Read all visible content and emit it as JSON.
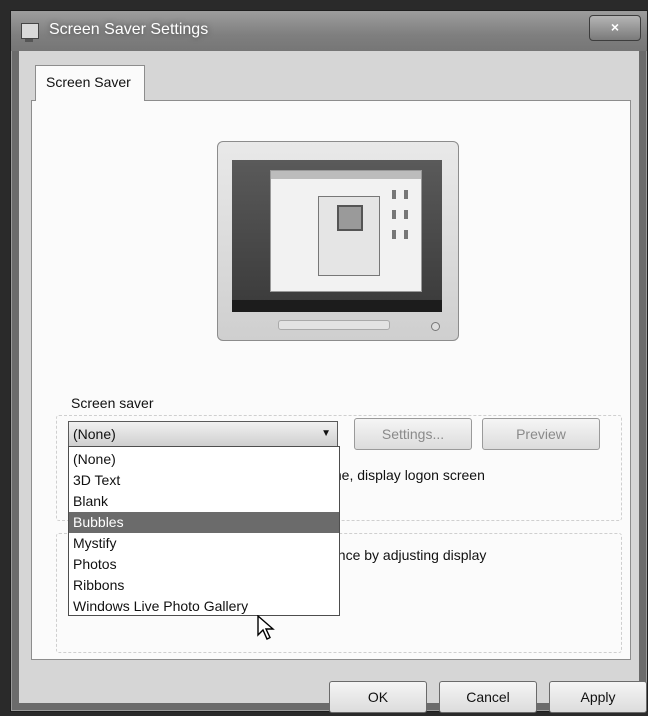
{
  "window": {
    "title": "Screen Saver Settings",
    "close_label": "×"
  },
  "tabs": [
    {
      "label": "Screen Saver"
    }
  ],
  "screen_saver": {
    "group_label": "Screen saver",
    "selected_value": "(None)",
    "settings_label": "Settings...",
    "preview_label": "Preview",
    "logon_text": "me, display logon screen",
    "power_text": "ance by adjusting display",
    "dropdown_options": [
      "(None)",
      "3D Text",
      "Blank",
      "Bubbles",
      "Mystify",
      "Photos",
      "Ribbons",
      "Windows Live Photo Gallery"
    ],
    "highlighted_option": "Bubbles"
  },
  "buttons": {
    "ok": "OK",
    "cancel": "Cancel",
    "apply": "Apply"
  },
  "icons": {
    "window_icon": "display-icon",
    "combo_arrow": "chevron-down-icon",
    "cursor": "mouse-pointer-icon"
  }
}
